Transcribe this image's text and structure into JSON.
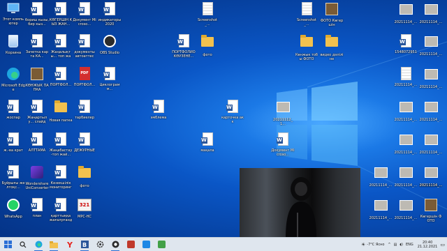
{
  "desktop": {
    "icons": [
      {
        "id": "this-pc",
        "label": "Этот компьютер",
        "kind": "pc"
      },
      {
        "id": "doc-1",
        "label": "бориш кызы, бир кыз...",
        "kind": "doc"
      },
      {
        "id": "doc-2",
        "label": "КӨГЕРШІН КЫЗ ЖАН...",
        "kind": "doc"
      },
      {
        "id": "doc-3",
        "label": "Документ Microso...",
        "kind": "doc"
      },
      {
        "id": "doc-4",
        "label": "индикаторы 2020",
        "kind": "doc"
      },
      {
        "id": "recycle-bin",
        "label": "Корзина",
        "kind": "recycle"
      },
      {
        "id": "doc-5",
        "label": "Зачетка карта КА...",
        "kind": "doc"
      },
      {
        "id": "doc-6",
        "label": "Жаңалықты... топ жай...",
        "kind": "doc"
      },
      {
        "id": "doc-7",
        "label": "документы автоаттест...",
        "kind": "doc"
      },
      {
        "id": "obs",
        "label": "OBS Studio",
        "kind": "obs"
      },
      {
        "id": "edge",
        "label": "Microsoft Edge",
        "kind": "edge"
      },
      {
        "id": "folder-1",
        "label": "КӨНЖЫК ПАПКА",
        "kind": "photo"
      },
      {
        "id": "doc-8",
        "label": "ПОРТФОЛ...",
        "kind": "doc"
      },
      {
        "id": "pdf-1",
        "label": "ПОРТФОЛ...",
        "kind": "pdf"
      },
      {
        "id": "doc-9",
        "label": "Циклограмм...",
        "kind": "doc"
      },
      {
        "id": "doc-10",
        "label": "жоспар",
        "kind": "doc"
      },
      {
        "id": "doc-11",
        "label": "Жаңартылу... слайд",
        "kind": "doc"
      },
      {
        "id": "folder-2",
        "label": "Новая папка",
        "kind": "folder"
      },
      {
        "id": "doc-12",
        "label": "тарбиелер",
        "kind": "doc"
      },
      {
        "id": "doc-13",
        "label": "ж.-ва крат",
        "kind": "doc"
      },
      {
        "id": "doc-14",
        "label": "АЛТТАМА",
        "kind": "doc"
      },
      {
        "id": "doc-15",
        "label": "Жаңабастау-топ жай...",
        "kind": "doc"
      },
      {
        "id": "doc-16",
        "label": "ДЕЖУРНЫЕ",
        "kind": "doc"
      },
      {
        "id": "doc-17",
        "label": "Бұйрығы желтоқс...",
        "kind": "doc"
      },
      {
        "id": "wondershare",
        "label": "Wondershare UniConverter",
        "kind": "wondershare"
      },
      {
        "id": "doc-18",
        "label": "Кезекшілік мониторинг",
        "kind": "doc"
      },
      {
        "id": "folder-3",
        "label": "фото",
        "kind": "folder"
      },
      {
        "id": "whatsapp",
        "label": "WhatsApp",
        "kind": "whatsapp"
      },
      {
        "id": "doc-19",
        "label": "план",
        "kind": "doc"
      },
      {
        "id": "doc-20",
        "label": "қарттыққа жағалуғандар",
        "kind": "doc"
      },
      {
        "id": "mpc",
        "label": "MPC-HC",
        "kind": "mpc"
      },
      {
        "id": "doc-21",
        "label": "ПОРТФОЛИО КӨУЗЕНЕ...",
        "kind": "doc"
      },
      {
        "id": "folder-4",
        "label": "фото",
        "kind": "folder"
      },
      {
        "id": "screenshot-1",
        "label": "Screenshot_...",
        "kind": "plain"
      },
      {
        "id": "doc-22",
        "label": "эмблема",
        "kind": "doc"
      },
      {
        "id": "doc-23",
        "label": "карточка акк",
        "kind": "doc"
      },
      {
        "id": "doc-24",
        "label": "мақала",
        "kind": "doc"
      },
      {
        "id": "thumb-1",
        "label": "20211112_1...",
        "kind": "thumb"
      },
      {
        "id": "doc-25",
        "label": "Документ Microso...",
        "kind": "doc"
      },
      {
        "id": "screenshot-2",
        "label": "Screenshot_...",
        "kind": "plain"
      },
      {
        "id": "photo-1",
        "label": "ФОТО Көгершін",
        "kind": "photo"
      },
      {
        "id": "folder-5",
        "label": "Көнжык тобы ФОТО",
        "kind": "folder"
      },
      {
        "id": "folder-6",
        "label": "видео дәліліне",
        "kind": "folder"
      },
      {
        "id": "r-1",
        "label": "20211114_...",
        "kind": "thumb"
      },
      {
        "id": "r-2",
        "label": "20211114_...",
        "kind": "thumb"
      },
      {
        "id": "r-3",
        "label": "1548072951",
        "kind": "doc"
      },
      {
        "id": "r-4",
        "label": "20211114_...",
        "kind": "thumb"
      },
      {
        "id": "r-5",
        "label": "20211114_...",
        "kind": "plain"
      },
      {
        "id": "r-6",
        "label": "20211114_...",
        "kind": "thumb"
      },
      {
        "id": "r-7",
        "label": "20211114_...",
        "kind": "thumb"
      },
      {
        "id": "r-8",
        "label": "20211114_...",
        "kind": "thumb"
      },
      {
        "id": "r-9",
        "label": "20211114_...",
        "kind": "thumb"
      },
      {
        "id": "r-10",
        "label": "20211114_...",
        "kind": "thumb"
      },
      {
        "id": "r-11",
        "label": "20211114_...",
        "kind": "thumb"
      },
      {
        "id": "r-12",
        "label": "20211114_...",
        "kind": "thumb"
      },
      {
        "id": "r-13",
        "label": "20211114_...",
        "kind": "thumb"
      },
      {
        "id": "r-14",
        "label": "20211114_...",
        "kind": "thumb"
      },
      {
        "id": "r-15",
        "label": "20211114_...",
        "kind": "thumb"
      },
      {
        "id": "r-16",
        "label": "20211114_...",
        "kind": "thumb"
      },
      {
        "id": "r-17",
        "label": "Көгершін ФОТО",
        "kind": "photo"
      }
    ]
  },
  "taskbar": {
    "apps": [
      {
        "id": "start",
        "icon": "windows-logo"
      },
      {
        "id": "search",
        "icon": "search-icon"
      },
      {
        "id": "edge",
        "icon": "edge-icon"
      },
      {
        "id": "explorer",
        "icon": "folder-icon"
      },
      {
        "id": "yandex",
        "icon": "yandex-icon"
      },
      {
        "id": "word",
        "icon": "word-icon"
      },
      {
        "id": "settings",
        "icon": "gear-icon"
      },
      {
        "id": "obs",
        "icon": "obs-icon"
      },
      {
        "id": "app-9",
        "icon": "app-icon"
      },
      {
        "id": "app-10",
        "icon": "app-icon"
      },
      {
        "id": "app-11",
        "icon": "app-icon"
      }
    ],
    "tray": {
      "weather": "-7°C Ясно",
      "language": "ENG",
      "time": "20:40",
      "date": "21.12.2021"
    }
  },
  "colors": {
    "accent": "#2a6fd6",
    "wallpaper": "#0a56c6"
  }
}
